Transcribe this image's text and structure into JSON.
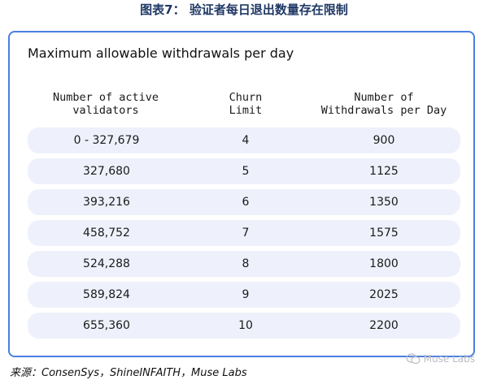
{
  "figure": {
    "title": "图表7：  验证者每日退出数量存在限制"
  },
  "card": {
    "title": "Maximum allowable withdrawals per day"
  },
  "table": {
    "headers": [
      "Number of active\nvalidators",
      "Churn\nLimit",
      "Number of\nWithdrawals per Day"
    ],
    "rows": [
      [
        "0 - 327,679",
        "4",
        "900"
      ],
      [
        "327,680",
        "5",
        "1125"
      ],
      [
        "393,216",
        "6",
        "1350"
      ],
      [
        "458,752",
        "7",
        "1575"
      ],
      [
        "524,288",
        "8",
        "1800"
      ],
      [
        "589,824",
        "9",
        "2025"
      ],
      [
        "655,360",
        "10",
        "2200"
      ]
    ]
  },
  "source": {
    "text": "来源：ConsenSys，ShineINFAITH，Muse Labs"
  },
  "watermark": {
    "text": "Muse Labs",
    "icon": "wechat-icon"
  },
  "colors": {
    "title": "#1f3864",
    "card_border": "#4a7fe0",
    "row_background": "#eef1fb"
  }
}
